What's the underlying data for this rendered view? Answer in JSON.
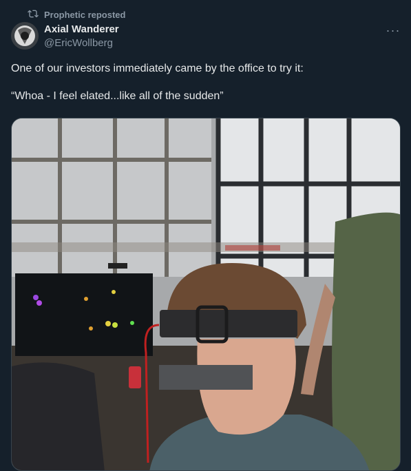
{
  "repost": {
    "icon": "repost-icon",
    "label": "Prophetic reposted"
  },
  "author": {
    "name": "Axial Wanderer",
    "handle": "@EricWollberg",
    "avatar_icon": "avatar"
  },
  "menu": {
    "icon": "more-horizontal-icon",
    "label": "···"
  },
  "tweet": {
    "line1": "One of our investors immediately came by the office to try it:",
    "line2": "“Whoa - I feel elated...like all of the sudden”"
  },
  "colors": {
    "background": "#15202b",
    "secondary_text": "#8b98a5",
    "primary_text": "#e7e9ea",
    "border": "#38444d"
  }
}
